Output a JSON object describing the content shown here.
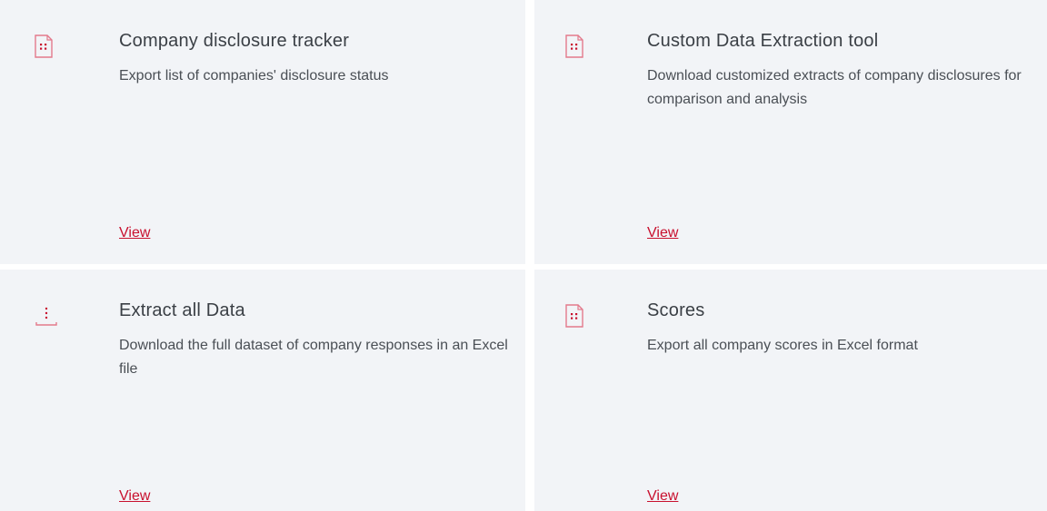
{
  "cards": [
    {
      "title": "Company disclosure tracker",
      "description": "Export list of companies' disclosure status",
      "link": "View",
      "icon": "excel-file-icon"
    },
    {
      "title": "Custom Data Extraction tool",
      "description": "Download customized extracts of company disclosures for comparison and analysis",
      "link": "View",
      "icon": "excel-file-icon"
    },
    {
      "title": "Extract all Data",
      "description": "Download the full dataset of company responses in an Excel file",
      "link": "View",
      "icon": "download-icon"
    },
    {
      "title": "Scores",
      "description": "Export all company scores in Excel format",
      "link": "View",
      "icon": "excel-file-icon"
    }
  ],
  "colors": {
    "card_background": "#f2f4f7",
    "accent": "#c8102e",
    "title_text": "#3a3f45",
    "body_text": "#4a4f55"
  }
}
